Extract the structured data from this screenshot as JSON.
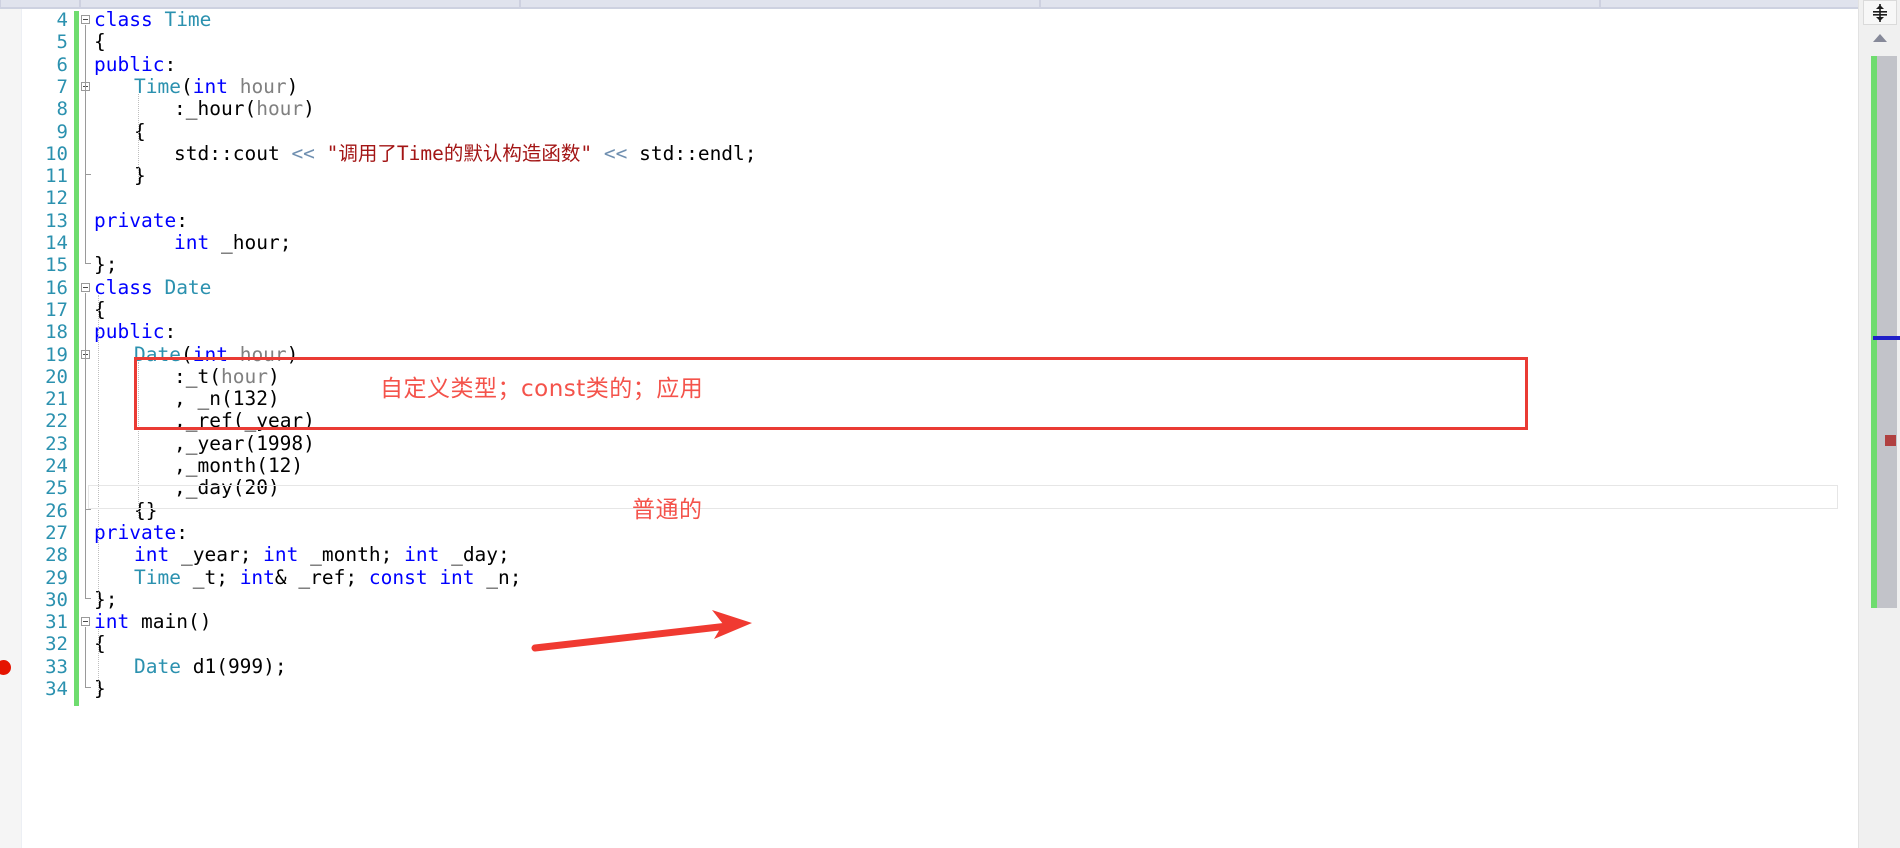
{
  "app": {
    "name": "visual-studio-code-editor",
    "language": "cpp"
  },
  "toolbar": {
    "visible_strip": true
  },
  "editor": {
    "first_line": 4,
    "last_line": 34,
    "current_line": 25,
    "breakpoint_line": 33,
    "lines": [
      {
        "num": "4",
        "indent": 0,
        "fold": "open",
        "text": "class Time"
      },
      {
        "num": "5",
        "indent": 0,
        "fold": "",
        "text": "{"
      },
      {
        "num": "6",
        "indent": 0,
        "fold": "",
        "text": "public:"
      },
      {
        "num": "7",
        "indent": 1,
        "fold": "open",
        "text": "Time(int hour)"
      },
      {
        "num": "8",
        "indent": 2,
        "fold": "",
        "text": ":_hour(hour)"
      },
      {
        "num": "9",
        "indent": 1,
        "fold": "",
        "text": "{"
      },
      {
        "num": "10",
        "indent": 2,
        "fold": "",
        "text": "std::cout << \"调用了Time的默认构造函数\" << std::endl;"
      },
      {
        "num": "11",
        "indent": 1,
        "fold": "",
        "text": "}"
      },
      {
        "num": "12",
        "indent": 0,
        "fold": "",
        "text": ""
      },
      {
        "num": "13",
        "indent": 0,
        "fold": "",
        "text": "private:"
      },
      {
        "num": "14",
        "indent": 2,
        "fold": "",
        "text": "int _hour;"
      },
      {
        "num": "15",
        "indent": 0,
        "fold": "",
        "text": "};"
      },
      {
        "num": "16",
        "indent": 0,
        "fold": "open",
        "text": "class Date"
      },
      {
        "num": "17",
        "indent": 0,
        "fold": "",
        "text": "{"
      },
      {
        "num": "18",
        "indent": 0,
        "fold": "",
        "text": "public:"
      },
      {
        "num": "19",
        "indent": 1,
        "fold": "open",
        "text": "Date(int hour)"
      },
      {
        "num": "20",
        "indent": 2,
        "fold": "",
        "text": ":_t(hour)"
      },
      {
        "num": "21",
        "indent": 2,
        "fold": "",
        "text": ", _n(132)"
      },
      {
        "num": "22",
        "indent": 2,
        "fold": "",
        "text": ",_ref(_year)"
      },
      {
        "num": "23",
        "indent": 2,
        "fold": "",
        "text": ",_year(1998)"
      },
      {
        "num": "24",
        "indent": 2,
        "fold": "",
        "text": ",_month(12)"
      },
      {
        "num": "25",
        "indent": 2,
        "fold": "",
        "text": ",_day(20)"
      },
      {
        "num": "26",
        "indent": 1,
        "fold": "",
        "text": "{}"
      },
      {
        "num": "27",
        "indent": 0,
        "fold": "",
        "text": "private:"
      },
      {
        "num": "28",
        "indent": 1,
        "fold": "",
        "text": "int _year; int _month; int _day;"
      },
      {
        "num": "29",
        "indent": 1,
        "fold": "",
        "text": "Time _t; int& _ref; const int _n;"
      },
      {
        "num": "30",
        "indent": 0,
        "fold": "",
        "text": "};"
      },
      {
        "num": "31",
        "indent": 0,
        "fold": "open",
        "text": "int main()"
      },
      {
        "num": "32",
        "indent": 0,
        "fold": "",
        "text": "{"
      },
      {
        "num": "33",
        "indent": 1,
        "fold": "",
        "text": "Date d1(999);"
      },
      {
        "num": "34",
        "indent": 0,
        "fold": "",
        "text": "}"
      }
    ],
    "string_literal": "\"调用了Time的默认构造函数\""
  },
  "annotations": [
    {
      "id": "rect-annotation",
      "type": "rectangle",
      "label": "自定义类型；const类的；应用",
      "color": "#ea3b34",
      "text_color": "#f4534b"
    },
    {
      "id": "arrow-annotation",
      "type": "arrow",
      "label": "普通的",
      "color": "#f03a31",
      "text_color": "#f4534b"
    }
  ],
  "scrollbar": {
    "split_icon": "split-view-icon",
    "up_arrow": "chevron-up-icon",
    "caret_marker_color": "#2020c8",
    "breakpoint_marker_color": "#b04040",
    "changes_color": "#6fdc6f"
  },
  "colors": {
    "keyword": "#0000ff",
    "type": "#2b91af",
    "string": "#a31515",
    "operator": "#6f8fb0",
    "parameter": "#808080",
    "line_number": "#2b91af",
    "change_bar": "#6fdc6f",
    "breakpoint": "#e51400"
  }
}
